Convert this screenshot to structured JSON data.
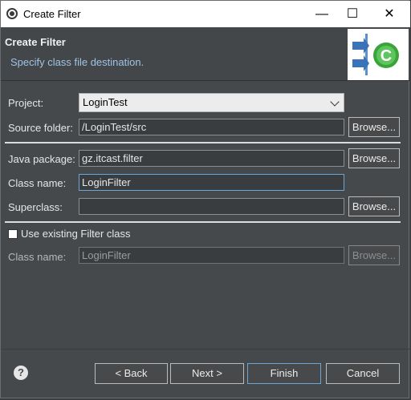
{
  "window": {
    "title": "Create Filter",
    "controls": [
      "—",
      "☐",
      "✕"
    ]
  },
  "header": {
    "title": "Create Filter",
    "subtitle": "Specify class file destination."
  },
  "form": {
    "project_label": "Project:",
    "project_value": "LoginTest",
    "source_label": "Source folder:",
    "source_value": "/LoginTest/src",
    "package_label": "Java package:",
    "package_value": "gz.itcast.filter",
    "class_label": "Class name:",
    "class_value": "LoginFilter",
    "super_label": "Superclass:",
    "super_value": "",
    "use_existing_label": "Use existing Filter class",
    "use_existing_checked": false,
    "existing_class_label": "Class name:",
    "existing_class_value": "LoginFilter",
    "browse_label": "Browse..."
  },
  "footer": {
    "help": "?",
    "back": "< Back",
    "next": "Next >",
    "finish": "Finish",
    "cancel": "Cancel"
  }
}
